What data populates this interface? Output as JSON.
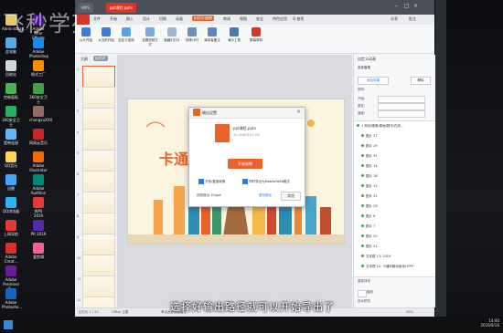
{
  "watermark": "飞秒学苑",
  "subtitle": "选择好输出路径就可以开始导出了",
  "desktop": {
    "icons": [
      {
        "label": "Administrat...",
        "color": "#e9c46a"
      },
      {
        "label": "此电脑",
        "color": "#5aa9e6"
      },
      {
        "label": "回收站",
        "color": "#cfd8dc"
      },
      {
        "label": "控制面板",
        "color": "#4caf50"
      },
      {
        "label": "360安全卫士",
        "color": "#27ae60"
      },
      {
        "label": "宽带连接",
        "color": "#64b5f6"
      },
      {
        "label": "QQ音乐",
        "color": "#ffd54f"
      },
      {
        "label": "迅雷",
        "color": "#42a5f5"
      },
      {
        "label": "QQ浏览器",
        "color": "#29b6f6"
      },
      {
        "label": "上网导航",
        "color": "#e53935"
      },
      {
        "label": "Adobe Creat...",
        "color": "#d32f2f"
      },
      {
        "label": "Adobe Premiere P...",
        "color": "#6a1b9a"
      },
      {
        "label": "Adobe Photosho...",
        "color": "#1565c0"
      },
      {
        "label": "Adobe After Effects CC",
        "color": "#4a148c"
      },
      {
        "label": "Adobe Photoshop",
        "color": "#1e88e5"
      },
      {
        "label": "格式工厂",
        "color": "#fb8c00"
      },
      {
        "label": "360安全卫士",
        "color": "#43a047"
      },
      {
        "label": "chongxuXXX",
        "color": "#8d6e63"
      },
      {
        "label": "网易云音乐",
        "color": "#c62828"
      },
      {
        "label": "Adobe Illustrator",
        "color": "#ef6c00"
      },
      {
        "label": "Adobe Audition",
        "color": "#00897b"
      },
      {
        "label": "WPS 2019",
        "color": "#e53935"
      },
      {
        "label": "PR 2019",
        "color": "#512da8"
      },
      {
        "label": "爱剪辑",
        "color": "#f06292"
      }
    ]
  },
  "wps": {
    "tabs": [
      "WPS",
      "ppt课程.pptx"
    ],
    "menu": [
      "文件",
      "开始",
      "插入",
      "设计",
      "切换",
      "动画",
      "幻灯片放映",
      "审阅",
      "视图",
      "安全",
      "特色应用",
      "Q 查找"
    ],
    "active_menu": "幻灯片放映",
    "menu_right": [
      "分享",
      "批注"
    ],
    "ribbon": [
      "从头开始",
      "从当前开始",
      "自定义放映",
      "设置放映方式",
      "隐藏幻灯片",
      "排练计时",
      "演讲者备注",
      "演示工具",
      "屏幕录制"
    ],
    "thumbs_header": [
      "大纲",
      "幻灯片"
    ],
    "slide_numbers": [
      "1",
      "2",
      "3",
      "4",
      "5",
      "6",
      "7",
      "8",
      "9",
      "10",
      "11",
      "12"
    ],
    "slide_title": "卡通",
    "status": {
      "slide": "幻灯片 1 / 27",
      "theme": "Office 主题",
      "notes": "单击此处添加备注",
      "zoom": "40%"
    }
  },
  "dialog": {
    "title": "输出设置",
    "file_name": "ppt课程.pptx",
    "file_size": "46.0MB/共94.2M",
    "start_button": "开始录制",
    "option1": "开放/直接转换",
    "option2": "同时导出为Mobile/Web格式",
    "path_label": "视频路径:",
    "path": "D:\\ppt",
    "change_button": "更改路径",
    "browse_button": "浏览"
  },
  "rpanel": {
    "title": "自定义动画",
    "select": "选择窗格",
    "add_button": "添加效果",
    "delete_button": "删除",
    "modify_label": "修改:",
    "start_label": "开始:",
    "property_label": "属性:",
    "speed_label": "速度:",
    "items": [
      "1 网页/图像/原画/数字/在线...",
      "图片 27",
      "图片 29",
      "图片 31",
      "图片 14",
      "图片 18",
      "图片 15",
      "图片 22",
      "图片 28",
      "图片 6",
      "图片 7",
      "图片 20",
      "图片 21",
      "文本框 13: 2019",
      "文本框 12: 卡通风格动画设计PPT"
    ],
    "reorder_label": "重新排序",
    "play_button": "播放",
    "preview_label": "自动预览"
  },
  "taskbar": {
    "time": "14:40",
    "date": "2019/9/16"
  },
  "colors": {
    "accent": "#e9622a",
    "wps_red": "#d6362b",
    "selection": "#2f7fd6"
  }
}
